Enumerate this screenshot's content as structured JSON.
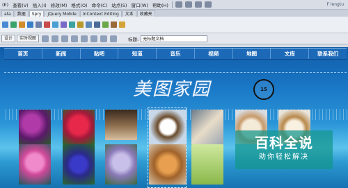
{
  "menubar": {
    "items": [
      "(E)",
      "查看(V)",
      "插入(I)",
      "修改(M)",
      "格式(O)",
      "命令(C)",
      "站点(S)",
      "窗口(W)",
      "帮助(H)"
    ],
    "brand": "F lengtu"
  },
  "insert_tabs": [
    "ata",
    "数据",
    "Spry",
    "jQuery Mobile",
    "InContext Editing",
    "文本",
    "收藏夹"
  ],
  "doc_toolbar": {
    "design_label": "设计",
    "live_label": "实时视图",
    "title_label": "标题:",
    "title_value": "无标题文档"
  },
  "nav": {
    "items": [
      "首页",
      "新闻",
      "贴吧",
      "知道",
      "音乐",
      "视频",
      "地图",
      "文库",
      "联系我们"
    ]
  },
  "site": {
    "title": "美图家园",
    "counter": "15"
  },
  "photos": {
    "top": [
      "purple flowers",
      "red roses",
      "puppies litter",
      "beagle puppy",
      "puppy on floor",
      "white puppy",
      "small dog"
    ],
    "bottom": [
      "pink lotus",
      "blue flowers",
      "lilac flowers",
      "shiba puppy",
      "green field"
    ]
  },
  "watermark": {
    "main": "百科全说",
    "sub": "助你轻松解决"
  },
  "colors": {
    "nav_bg": "#1c69b8",
    "watermark": "#14968c"
  }
}
